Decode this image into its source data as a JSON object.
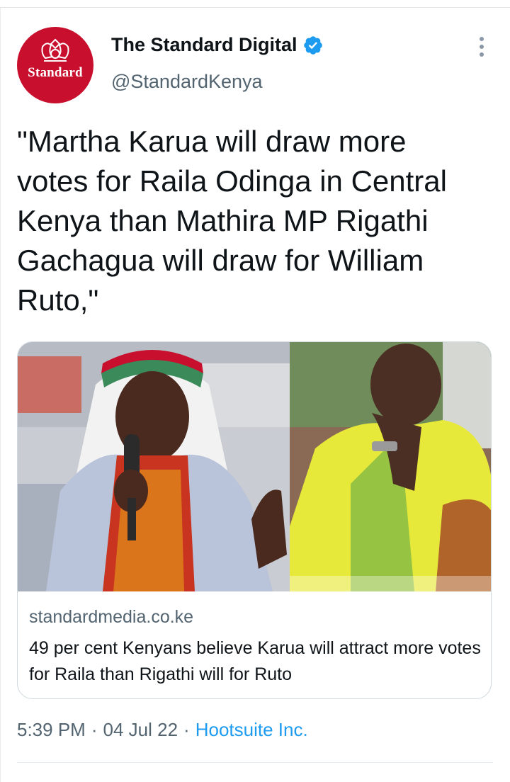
{
  "tweet": {
    "author": {
      "display_name": "The Standard Digital",
      "handle": "@StandardKenya",
      "avatar_text": "Standard",
      "verified": true
    },
    "text": "\"Martha Karua will draw more\nvotes for Raila Odinga in Central\nKenya than Mathira MP Rigathi\nGachagua will draw for William\nRuto,\"",
    "link_card": {
      "domain": "standardmedia.co.ke",
      "title": "49 per cent Kenyans believe Karua will attract more votes for Raila than Rigathi will for Ruto"
    },
    "meta": {
      "time": "5:39 PM",
      "separator": "·",
      "date": "04 Jul 22",
      "source": "Hootsuite Inc."
    }
  },
  "icons": {
    "verified": "verified-badge-icon",
    "more": "more-vertical-icon"
  },
  "colors": {
    "accent": "#1d9bf0",
    "brand_red": "#c8102e",
    "text_primary": "#0f1419",
    "text_secondary": "#536471",
    "border": "#cfd9de"
  }
}
